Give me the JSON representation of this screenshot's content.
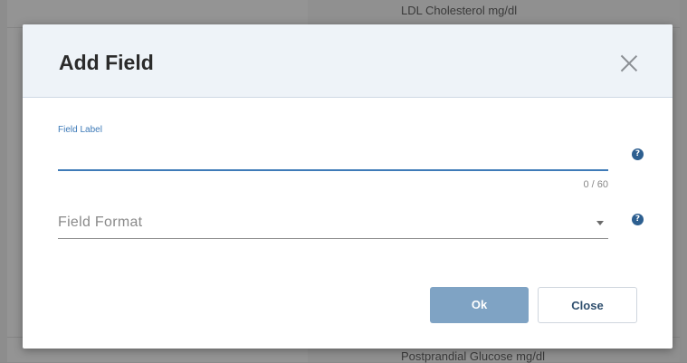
{
  "background": {
    "top_row_text": "LDL Cholesterol mg/dl",
    "bottom_row_text": "Postprandial Glucose mg/dl"
  },
  "dialog": {
    "title": "Add Field",
    "close_icon": "close-icon",
    "field_label": {
      "label": "Field Label",
      "value": "",
      "counter": "0 / 60",
      "help_icon": "help-icon"
    },
    "field_format": {
      "placeholder": "Field Format",
      "arrow_icon": "chevron-down-icon",
      "help_icon": "help-icon"
    },
    "buttons": {
      "ok": "Ok",
      "close": "Close"
    }
  },
  "colors": {
    "accent": "#3f7bb8",
    "ok_button": "#7fa3c4",
    "header_bg": "#eef3f8"
  }
}
